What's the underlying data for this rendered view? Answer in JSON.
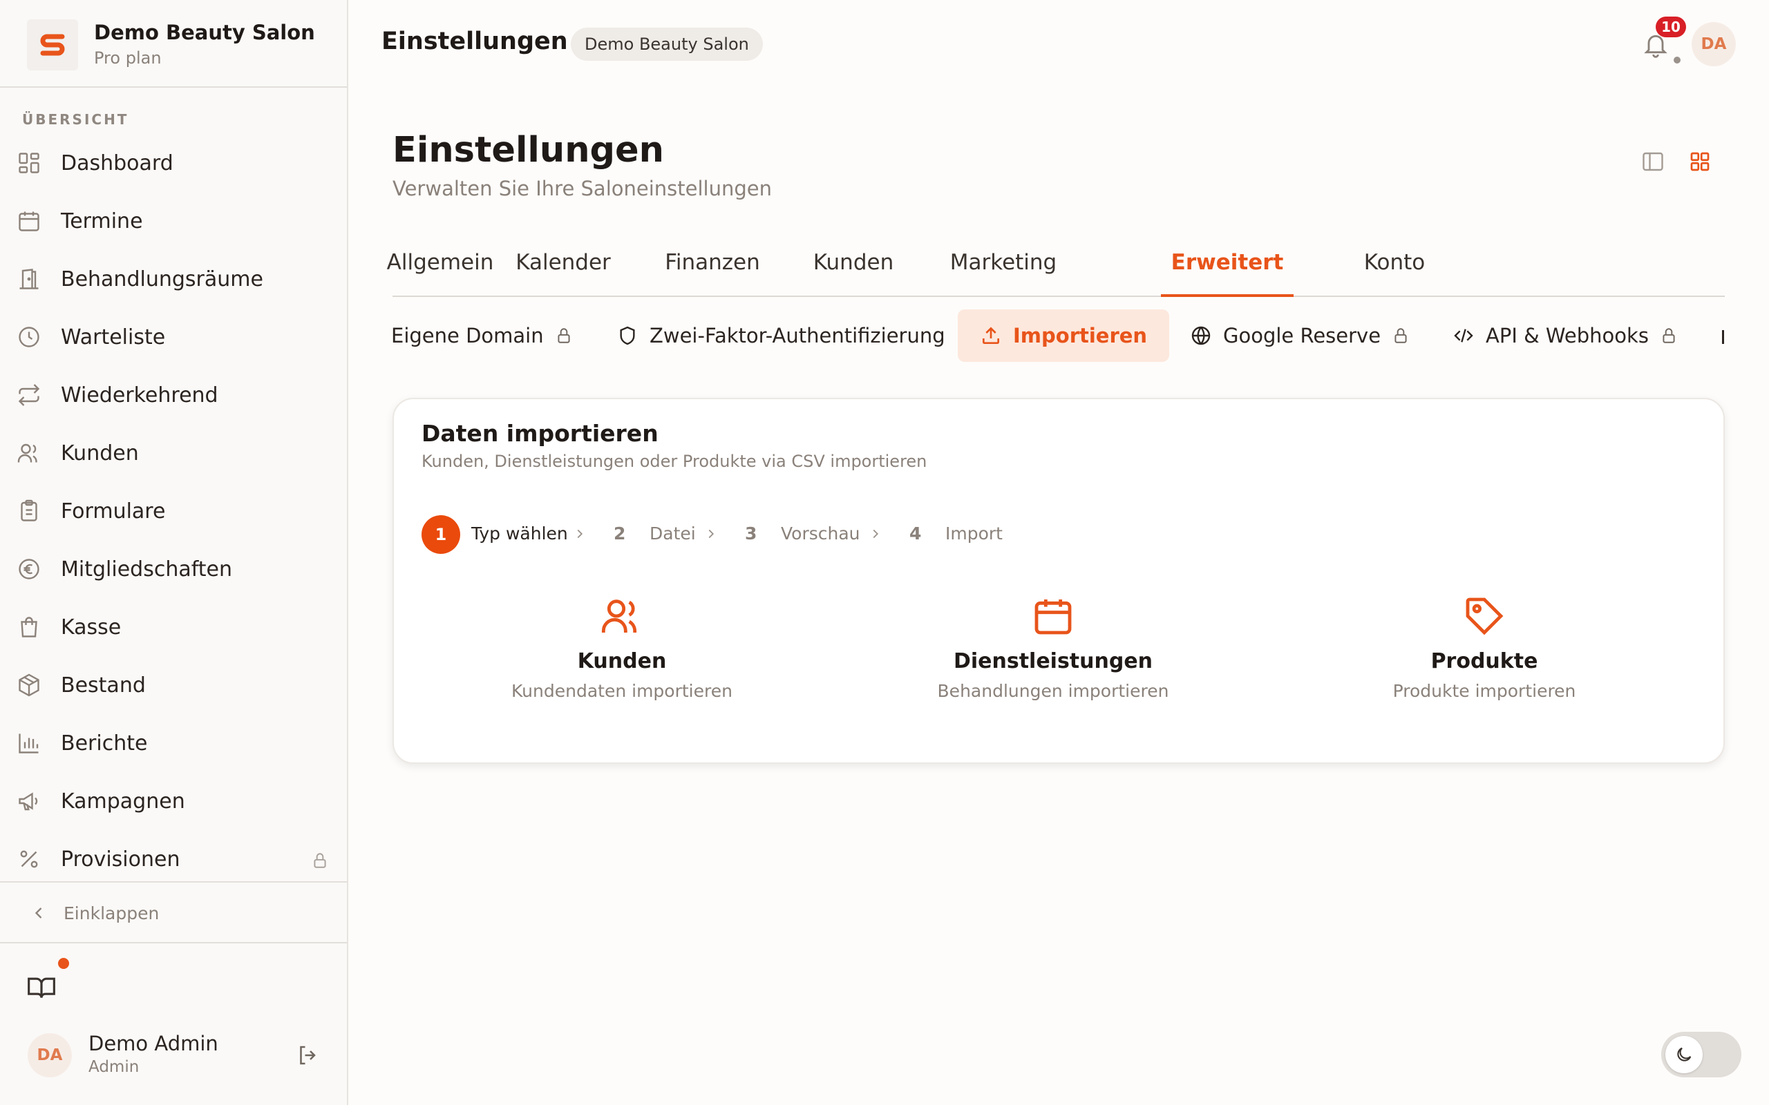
{
  "brand": {
    "name": "Demo Beauty Salon",
    "plan": "Pro plan",
    "accent": "#e8541a"
  },
  "sidebar": {
    "section_label": "ÜBERSICHT",
    "items": [
      {
        "label": "Dashboard",
        "icon": "dashboard-icon"
      },
      {
        "label": "Termine",
        "icon": "calendar-icon"
      },
      {
        "label": "Behandlungsräume",
        "icon": "door-icon"
      },
      {
        "label": "Warteliste",
        "icon": "clock-icon"
      },
      {
        "label": "Wiederkehrend",
        "icon": "repeat-icon"
      },
      {
        "label": "Kunden",
        "icon": "users-icon"
      },
      {
        "label": "Formulare",
        "icon": "clipboard-icon"
      },
      {
        "label": "Mitgliedschaften",
        "icon": "euro-icon"
      },
      {
        "label": "Kasse",
        "icon": "shopping-bag-icon"
      },
      {
        "label": "Bestand",
        "icon": "package-icon"
      },
      {
        "label": "Berichte",
        "icon": "bar-chart-icon"
      },
      {
        "label": "Kampagnen",
        "icon": "megaphone-icon"
      },
      {
        "label": "Provisionen",
        "icon": "percent-icon",
        "locked": true
      }
    ],
    "collapse_label": "Einklappen",
    "user": {
      "initials": "DA",
      "name": "Demo Admin",
      "role": "Admin"
    }
  },
  "topbar": {
    "title": "Einstellungen",
    "salon_chip": "Demo Beauty Salon",
    "notification_count": "10",
    "avatar_initials": "DA"
  },
  "page": {
    "title": "Einstellungen",
    "subtitle": "Verwalten Sie Ihre Saloneinstellungen"
  },
  "tabs": [
    {
      "label": "Allgemein"
    },
    {
      "label": "Kalender"
    },
    {
      "label": "Finanzen"
    },
    {
      "label": "Kunden"
    },
    {
      "label": "Marketing"
    },
    {
      "label": "Erweitert",
      "active": true
    },
    {
      "label": "Konto"
    }
  ],
  "subtabs": [
    {
      "label": "Eigene Domain",
      "locked": true
    },
    {
      "label": "Zwei-Faktor-Authentifizierung",
      "icon": "shield-icon"
    },
    {
      "label": "Importieren",
      "icon": "upload-icon",
      "active": true
    },
    {
      "label": "Google Reserve",
      "icon": "globe-icon",
      "locked": true
    },
    {
      "label": "API & Webhooks",
      "icon": "code-icon",
      "locked": true
    }
  ],
  "import": {
    "title": "Daten importieren",
    "subtitle": "Kunden, Dienstleistungen oder Produkte via CSV importieren",
    "steps": [
      {
        "num": "1",
        "label": "Typ wählen",
        "active": true
      },
      {
        "num": "2",
        "label": "Datei"
      },
      {
        "num": "3",
        "label": "Vorschau"
      },
      {
        "num": "4",
        "label": "Import"
      }
    ],
    "options": [
      {
        "title": "Kunden",
        "subtitle": "Kundendaten importieren",
        "icon": "users-icon"
      },
      {
        "title": "Dienstleistungen",
        "subtitle": "Behandlungen importieren",
        "icon": "calendar-icon"
      },
      {
        "title": "Produkte",
        "subtitle": "Produkte importieren",
        "icon": "tag-icon"
      }
    ]
  }
}
